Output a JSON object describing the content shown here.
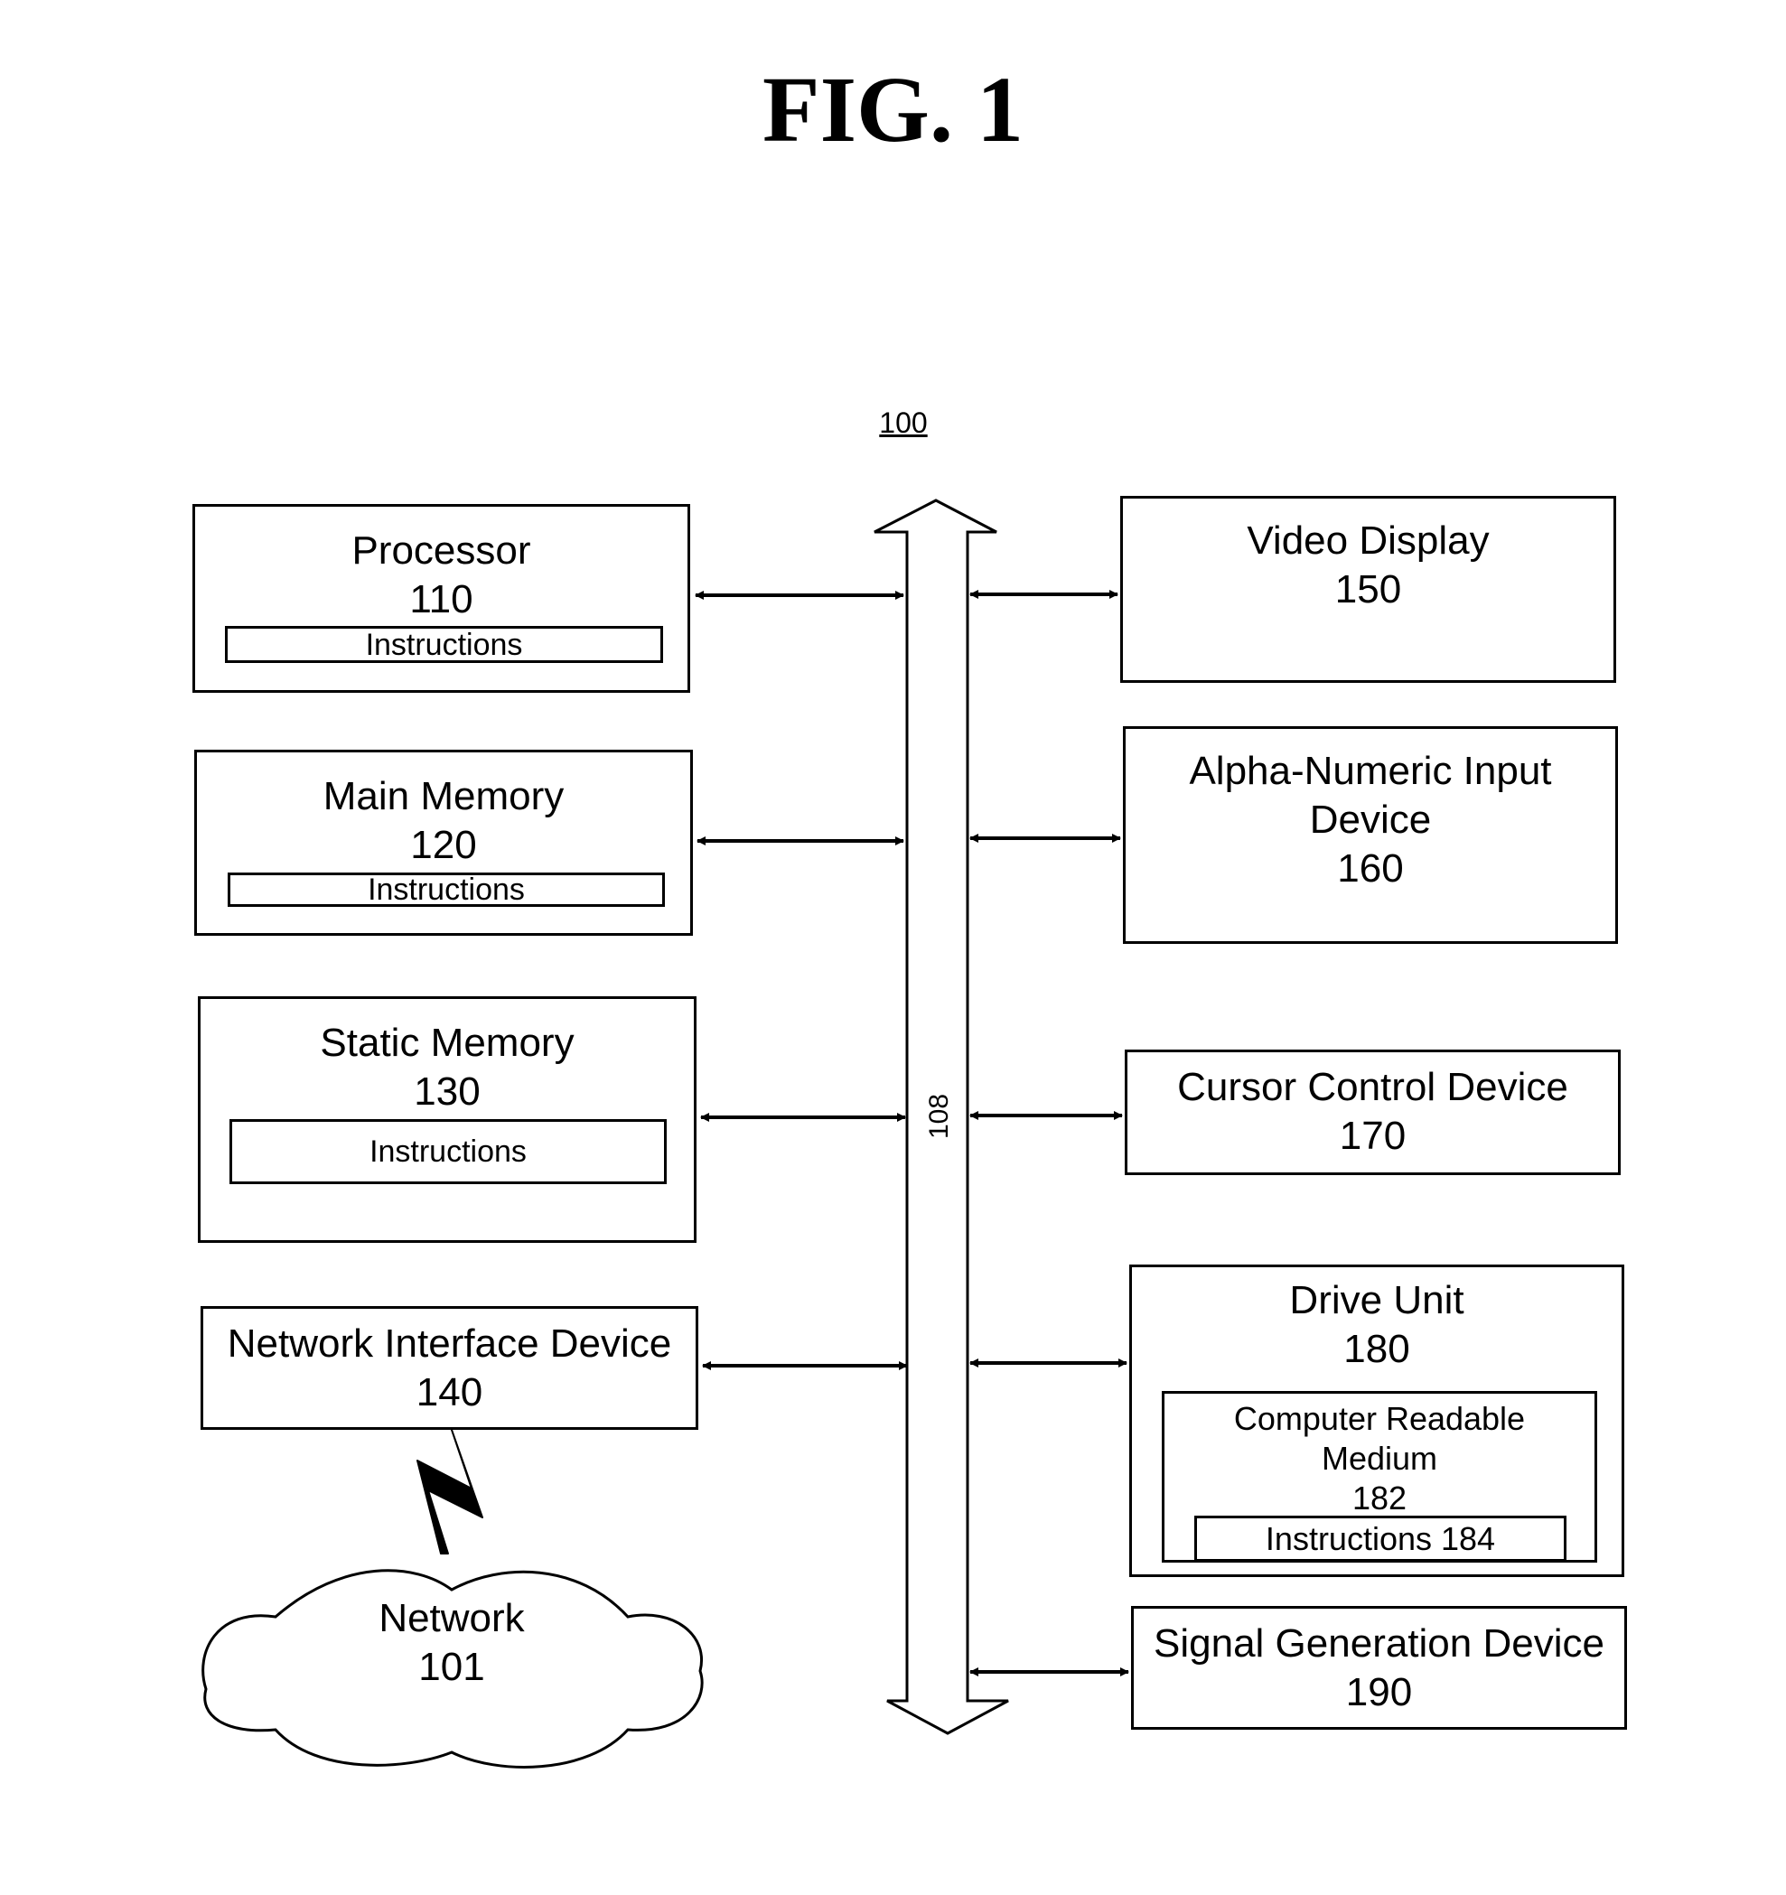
{
  "figure": {
    "title": "FIG. 1",
    "system_ref": "100",
    "bus_ref": "108"
  },
  "left_components": [
    {
      "name": "Processor",
      "ref": "110",
      "sub": "Instructions"
    },
    {
      "name": "Main Memory",
      "ref": "120",
      "sub": "Instructions"
    },
    {
      "name": "Static Memory",
      "ref": "130",
      "sub": "Instructions"
    },
    {
      "name": "Network Interface Device",
      "ref": "140"
    }
  ],
  "network": {
    "name": "Network",
    "ref": "101"
  },
  "right_components": [
    {
      "name": "Video Display",
      "ref": "150"
    },
    {
      "name_line1": "Alpha-Numeric Input",
      "name_line2": "Device",
      "ref": "160"
    },
    {
      "name": "Cursor Control Device",
      "ref": "170"
    },
    {
      "name": "Drive Unit",
      "ref": "180",
      "medium_line1": "Computer Readable",
      "medium_line2": "Medium",
      "medium_ref": "182",
      "instructions": "Instructions 184"
    },
    {
      "name": "Signal Generation Device",
      "ref": "190"
    }
  ]
}
